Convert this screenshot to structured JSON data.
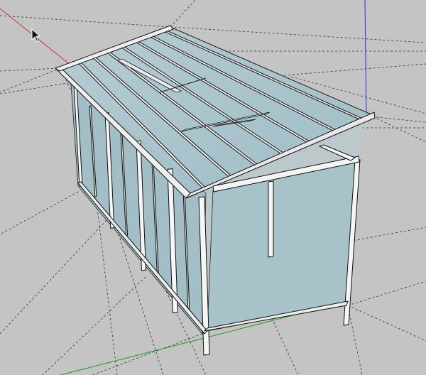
{
  "app": {
    "type": "3d-modeling-viewport"
  },
  "viewport": {
    "background_color": "#c4c4c4",
    "axis_colors": {
      "red": "#d03030",
      "green": "#1a9a1a",
      "blue": "#2a2ae0"
    },
    "glass_color": "#a8c4cc",
    "frame_color": "#f2f2f2",
    "edge_color": "#111111",
    "guide_color": "#333333"
  },
  "model": {
    "name": "glass-lean-to-shelter",
    "roof_rafter_count": 7,
    "front_post_count": 5,
    "back_post_count": 2
  },
  "cursor": {
    "icon": "arrow-cursor-icon"
  }
}
